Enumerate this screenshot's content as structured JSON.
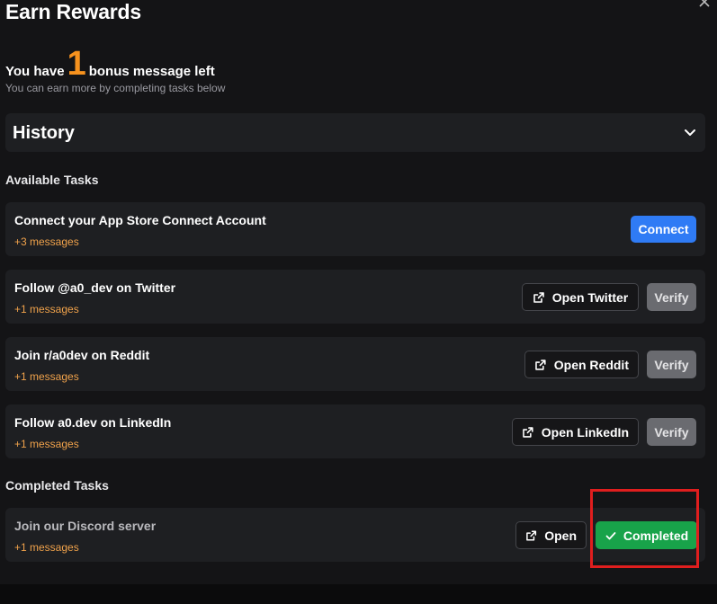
{
  "modal": {
    "title": "Earn Rewards",
    "bonus": {
      "prefix": "You have",
      "count": "1",
      "suffix": "bonus message left",
      "subtitle": "You can earn more by completing tasks below"
    },
    "history": {
      "label": "History"
    },
    "available": {
      "title": "Available Tasks",
      "tasks": [
        {
          "name": "Connect your App Store Connect Account",
          "reward": "+3 messages",
          "primary": "Connect"
        },
        {
          "name": "Follow @a0_dev on Twitter",
          "reward": "+1 messages",
          "open": "Open Twitter",
          "verify": "Verify"
        },
        {
          "name": "Join r/a0dev on Reddit",
          "reward": "+1 messages",
          "open": "Open Reddit",
          "verify": "Verify"
        },
        {
          "name": "Follow a0.dev on LinkedIn",
          "reward": "+1 messages",
          "open": "Open LinkedIn",
          "verify": "Verify"
        }
      ]
    },
    "completed": {
      "title": "Completed Tasks",
      "tasks": [
        {
          "name": "Join our Discord server",
          "reward": "+1 messages",
          "open": "Open",
          "status": "Completed"
        }
      ]
    }
  },
  "colors": {
    "accent_orange": "#f6921e",
    "connect_blue": "#2f7bf5",
    "completed_green": "#18a34a",
    "annotation_red": "#e01e1e"
  }
}
